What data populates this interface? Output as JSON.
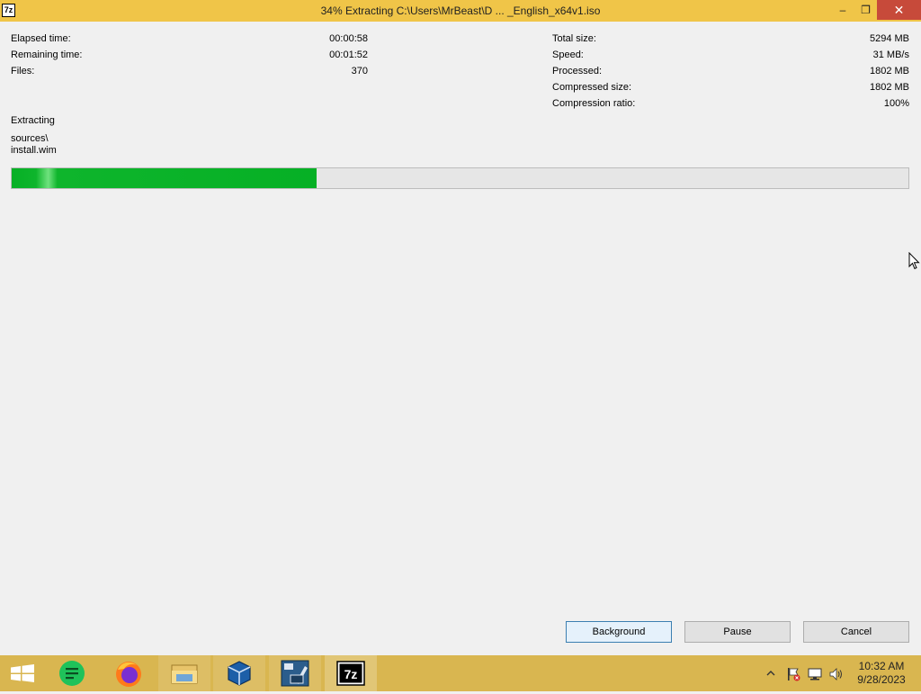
{
  "window": {
    "title": "34% Extracting C:\\Users\\MrBeast\\D ... _English_x64v1.iso",
    "app_icon_label": "7z",
    "controls": {
      "minimize": "–",
      "maximize": "❐",
      "close": "✕"
    }
  },
  "stats_left": [
    {
      "label": "Elapsed time:",
      "value": "00:00:58"
    },
    {
      "label": "Remaining time:",
      "value": "00:01:52"
    },
    {
      "label": "Files:",
      "value": "370"
    }
  ],
  "stats_right": [
    {
      "label": "Total size:",
      "value": "5294 MB"
    },
    {
      "label": "Speed:",
      "value": "31 MB/s"
    },
    {
      "label": "Processed:",
      "value": "1802 MB"
    },
    {
      "label": "Compressed size:",
      "value": "1802 MB"
    },
    {
      "label": "Compression ratio:",
      "value": "100%"
    }
  ],
  "status": {
    "operation": "Extracting",
    "path_line1": "sources\\",
    "path_line2": "install.wim"
  },
  "progress": {
    "percent": 34,
    "color": "#06b025"
  },
  "buttons": {
    "background": "Background",
    "pause": "Pause",
    "cancel": "Cancel"
  },
  "taskbar": {
    "items": [
      {
        "icon": "windows-start-icon"
      },
      {
        "icon": "notes-app-icon"
      },
      {
        "icon": "firefox-icon"
      },
      {
        "icon": "file-explorer-icon"
      },
      {
        "icon": "virtualbox-icon"
      },
      {
        "icon": "windows-11-iso-tool-icon"
      },
      {
        "icon": "7zip-icon",
        "label": "7z"
      }
    ],
    "tray_icons": [
      "show-hidden-icons-chevron-icon",
      "action-center-flag-icon",
      "network-icon",
      "volume-icon"
    ],
    "time": "10:32 AM",
    "date": "9/28/2023"
  },
  "colors": {
    "title_bar": "#f0c548",
    "taskbar": "#d9b650",
    "close_button": "#c74a3a"
  }
}
